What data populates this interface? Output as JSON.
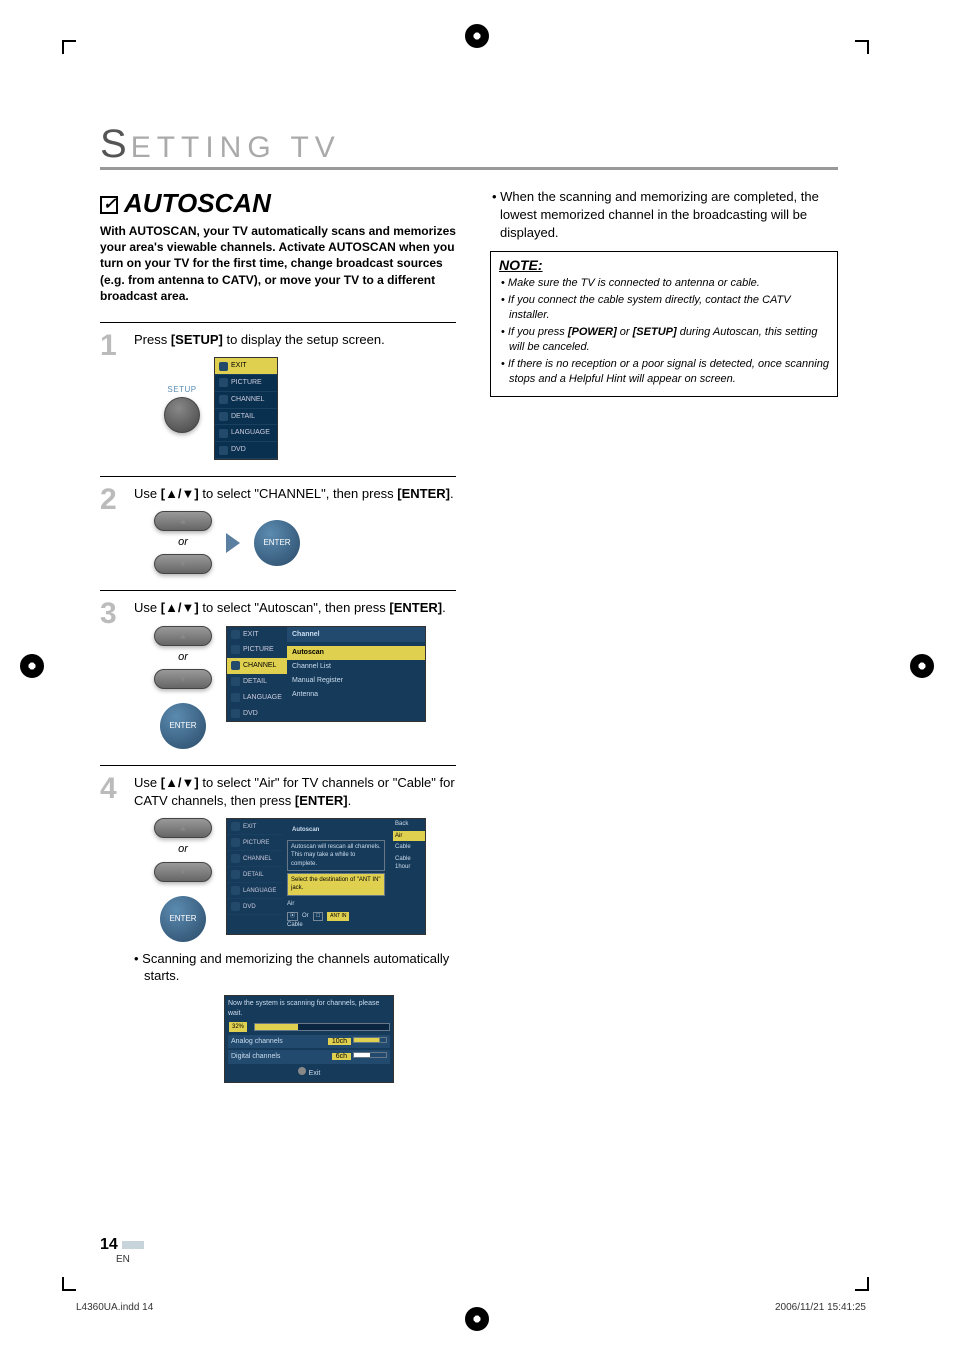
{
  "page": {
    "section_letter": "S",
    "section_rest": "ETTING  TV",
    "heading": "AUTOSCAN",
    "intro": "With AUTOSCAN, your TV automatically scans and memorizes your area's viewable channels.  Activate AUTOSCAN when you turn on your TV for the first time, change broadcast sources (e.g. from antenna to CATV), or move your TV to a different broadcast area.",
    "page_number": "14",
    "lang": "EN",
    "footer_left": "L4360UA.indd   14",
    "footer_right": "2006/11/21   15:41:25"
  },
  "steps": {
    "s1": {
      "num": "1",
      "text_pre": "Press ",
      "btn": "[SETUP]",
      "text_post": " to display the setup screen."
    },
    "s2": {
      "num": "2",
      "text_pre": "Use ",
      "keys": "[▲/▼]",
      "mid": " to select \"CHANNEL\", then press ",
      "btn": "[ENTER]",
      "end": "."
    },
    "s3": {
      "num": "3",
      "text_pre": "Use ",
      "keys": "[▲/▼]",
      "mid": " to select \"Autoscan\", then press ",
      "btn": "[ENTER]",
      "end": "."
    },
    "s4": {
      "num": "4",
      "text_pre": "Use ",
      "keys": "[▲/▼]",
      "mid": " to select \"Air\" for TV channels or \"Cable\" for CATV channels, then press ",
      "btn": "[ENTER]",
      "end": "."
    },
    "sub4": "• Scanning and memorizing the channels automatically starts."
  },
  "or_label": "or",
  "setup_label": "SETUP",
  "enter_label": "ENTER",
  "menu1": {
    "items": [
      "EXIT",
      "PICTURE",
      "CHANNEL",
      "DETAIL",
      "LANGUAGE",
      "DVD"
    ],
    "selected_index": 0
  },
  "menu3": {
    "title": "Channel",
    "items": [
      "Autoscan",
      "Channel List",
      "Manual Register",
      "Antenna"
    ],
    "selected_index": 0
  },
  "menu4": {
    "title": "Autoscan",
    "msg1": "Autoscan will rescan all channels. This may take a while to complete.",
    "msg2": "Select the destination of \"ANT IN\" jack.",
    "diag_labels": {
      "air": "Air",
      "or": "Or",
      "cable": "Cable",
      "antin": "ANT IN"
    },
    "opts": [
      "Back",
      "Air",
      "Cable",
      "Cable 1hour"
    ],
    "selected_index": 1
  },
  "progress": {
    "title": "Now the system is scanning for channels, please wait.",
    "percent": "32%",
    "analog_label": "Analog channels",
    "analog_count": "10ch",
    "digital_label": "Digital channels",
    "digital_count": "6ch",
    "exit": "Exit"
  },
  "right": {
    "bullet": "• When the scanning and memorizing are completed, the lowest memorized channel in the broadcasting will be displayed.",
    "note_head": "NOTE:",
    "notes": [
      "Make sure the TV is connected to antenna or cable.",
      "If you connect the cable system directly, contact the CATV installer.",
      "If you press <b>[POWER]</b> or <b>[SETUP]</b> during Autoscan, this setting will be canceled.",
      "If there is no reception or a poor signal is detected, once scanning stops and a Helpful Hint will appear on screen."
    ]
  }
}
